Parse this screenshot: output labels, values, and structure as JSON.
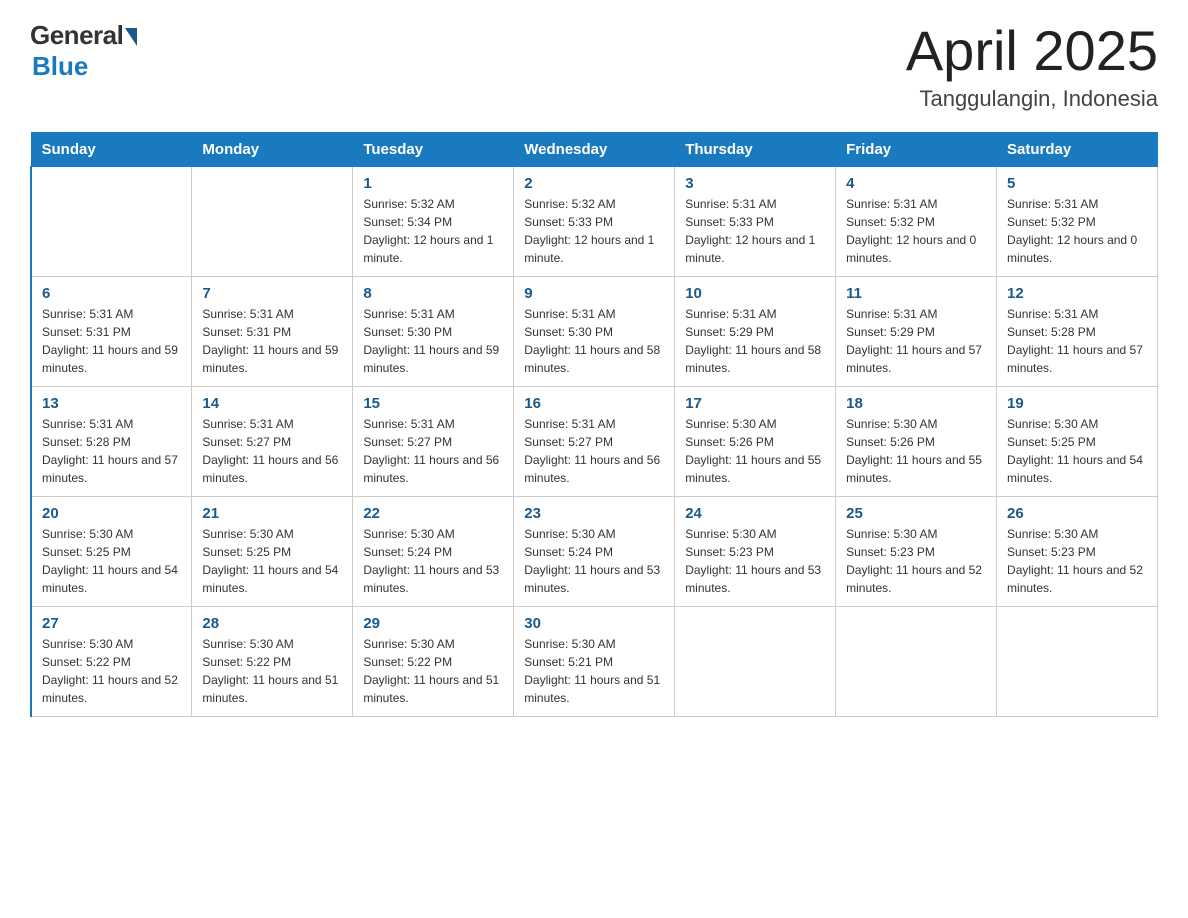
{
  "header": {
    "logo": {
      "general": "General",
      "blue": "Blue",
      "subtitle": "Blue"
    },
    "title": "April 2025",
    "location": "Tanggulangin, Indonesia"
  },
  "days_of_week": [
    "Sunday",
    "Monday",
    "Tuesday",
    "Wednesday",
    "Thursday",
    "Friday",
    "Saturday"
  ],
  "weeks": [
    [
      {
        "day": "",
        "sunrise": "",
        "sunset": "",
        "daylight": ""
      },
      {
        "day": "",
        "sunrise": "",
        "sunset": "",
        "daylight": ""
      },
      {
        "day": "1",
        "sunrise": "Sunrise: 5:32 AM",
        "sunset": "Sunset: 5:34 PM",
        "daylight": "Daylight: 12 hours and 1 minute."
      },
      {
        "day": "2",
        "sunrise": "Sunrise: 5:32 AM",
        "sunset": "Sunset: 5:33 PM",
        "daylight": "Daylight: 12 hours and 1 minute."
      },
      {
        "day": "3",
        "sunrise": "Sunrise: 5:31 AM",
        "sunset": "Sunset: 5:33 PM",
        "daylight": "Daylight: 12 hours and 1 minute."
      },
      {
        "day": "4",
        "sunrise": "Sunrise: 5:31 AM",
        "sunset": "Sunset: 5:32 PM",
        "daylight": "Daylight: 12 hours and 0 minutes."
      },
      {
        "day": "5",
        "sunrise": "Sunrise: 5:31 AM",
        "sunset": "Sunset: 5:32 PM",
        "daylight": "Daylight: 12 hours and 0 minutes."
      }
    ],
    [
      {
        "day": "6",
        "sunrise": "Sunrise: 5:31 AM",
        "sunset": "Sunset: 5:31 PM",
        "daylight": "Daylight: 11 hours and 59 minutes."
      },
      {
        "day": "7",
        "sunrise": "Sunrise: 5:31 AM",
        "sunset": "Sunset: 5:31 PM",
        "daylight": "Daylight: 11 hours and 59 minutes."
      },
      {
        "day": "8",
        "sunrise": "Sunrise: 5:31 AM",
        "sunset": "Sunset: 5:30 PM",
        "daylight": "Daylight: 11 hours and 59 minutes."
      },
      {
        "day": "9",
        "sunrise": "Sunrise: 5:31 AM",
        "sunset": "Sunset: 5:30 PM",
        "daylight": "Daylight: 11 hours and 58 minutes."
      },
      {
        "day": "10",
        "sunrise": "Sunrise: 5:31 AM",
        "sunset": "Sunset: 5:29 PM",
        "daylight": "Daylight: 11 hours and 58 minutes."
      },
      {
        "day": "11",
        "sunrise": "Sunrise: 5:31 AM",
        "sunset": "Sunset: 5:29 PM",
        "daylight": "Daylight: 11 hours and 57 minutes."
      },
      {
        "day": "12",
        "sunrise": "Sunrise: 5:31 AM",
        "sunset": "Sunset: 5:28 PM",
        "daylight": "Daylight: 11 hours and 57 minutes."
      }
    ],
    [
      {
        "day": "13",
        "sunrise": "Sunrise: 5:31 AM",
        "sunset": "Sunset: 5:28 PM",
        "daylight": "Daylight: 11 hours and 57 minutes."
      },
      {
        "day": "14",
        "sunrise": "Sunrise: 5:31 AM",
        "sunset": "Sunset: 5:27 PM",
        "daylight": "Daylight: 11 hours and 56 minutes."
      },
      {
        "day": "15",
        "sunrise": "Sunrise: 5:31 AM",
        "sunset": "Sunset: 5:27 PM",
        "daylight": "Daylight: 11 hours and 56 minutes."
      },
      {
        "day": "16",
        "sunrise": "Sunrise: 5:31 AM",
        "sunset": "Sunset: 5:27 PM",
        "daylight": "Daylight: 11 hours and 56 minutes."
      },
      {
        "day": "17",
        "sunrise": "Sunrise: 5:30 AM",
        "sunset": "Sunset: 5:26 PM",
        "daylight": "Daylight: 11 hours and 55 minutes."
      },
      {
        "day": "18",
        "sunrise": "Sunrise: 5:30 AM",
        "sunset": "Sunset: 5:26 PM",
        "daylight": "Daylight: 11 hours and 55 minutes."
      },
      {
        "day": "19",
        "sunrise": "Sunrise: 5:30 AM",
        "sunset": "Sunset: 5:25 PM",
        "daylight": "Daylight: 11 hours and 54 minutes."
      }
    ],
    [
      {
        "day": "20",
        "sunrise": "Sunrise: 5:30 AM",
        "sunset": "Sunset: 5:25 PM",
        "daylight": "Daylight: 11 hours and 54 minutes."
      },
      {
        "day": "21",
        "sunrise": "Sunrise: 5:30 AM",
        "sunset": "Sunset: 5:25 PM",
        "daylight": "Daylight: 11 hours and 54 minutes."
      },
      {
        "day": "22",
        "sunrise": "Sunrise: 5:30 AM",
        "sunset": "Sunset: 5:24 PM",
        "daylight": "Daylight: 11 hours and 53 minutes."
      },
      {
        "day": "23",
        "sunrise": "Sunrise: 5:30 AM",
        "sunset": "Sunset: 5:24 PM",
        "daylight": "Daylight: 11 hours and 53 minutes."
      },
      {
        "day": "24",
        "sunrise": "Sunrise: 5:30 AM",
        "sunset": "Sunset: 5:23 PM",
        "daylight": "Daylight: 11 hours and 53 minutes."
      },
      {
        "day": "25",
        "sunrise": "Sunrise: 5:30 AM",
        "sunset": "Sunset: 5:23 PM",
        "daylight": "Daylight: 11 hours and 52 minutes."
      },
      {
        "day": "26",
        "sunrise": "Sunrise: 5:30 AM",
        "sunset": "Sunset: 5:23 PM",
        "daylight": "Daylight: 11 hours and 52 minutes."
      }
    ],
    [
      {
        "day": "27",
        "sunrise": "Sunrise: 5:30 AM",
        "sunset": "Sunset: 5:22 PM",
        "daylight": "Daylight: 11 hours and 52 minutes."
      },
      {
        "day": "28",
        "sunrise": "Sunrise: 5:30 AM",
        "sunset": "Sunset: 5:22 PM",
        "daylight": "Daylight: 11 hours and 51 minutes."
      },
      {
        "day": "29",
        "sunrise": "Sunrise: 5:30 AM",
        "sunset": "Sunset: 5:22 PM",
        "daylight": "Daylight: 11 hours and 51 minutes."
      },
      {
        "day": "30",
        "sunrise": "Sunrise: 5:30 AM",
        "sunset": "Sunset: 5:21 PM",
        "daylight": "Daylight: 11 hours and 51 minutes."
      },
      {
        "day": "",
        "sunrise": "",
        "sunset": "",
        "daylight": ""
      },
      {
        "day": "",
        "sunrise": "",
        "sunset": "",
        "daylight": ""
      },
      {
        "day": "",
        "sunrise": "",
        "sunset": "",
        "daylight": ""
      }
    ]
  ]
}
